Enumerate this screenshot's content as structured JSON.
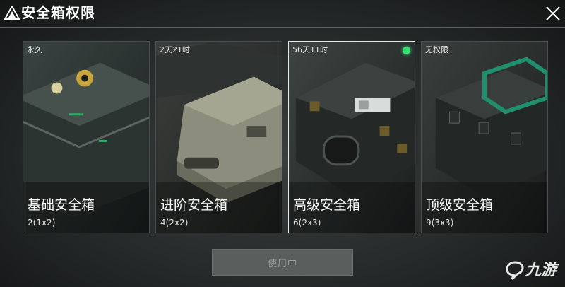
{
  "header": {
    "title": "安全箱权限",
    "logo_icon": "triangle-logo-icon",
    "close_icon": "close-icon"
  },
  "cards": [
    {
      "duration": "永久",
      "name": "基础安全箱",
      "size": "2(1x2)",
      "selected": false
    },
    {
      "duration": "2天21时",
      "name": "进阶安全箱",
      "size": "4(2x2)",
      "selected": false
    },
    {
      "duration": "56天11时",
      "name": "高级安全箱",
      "size": "6(2x3)",
      "selected": true
    },
    {
      "duration": "无权限",
      "name": "顶级安全箱",
      "size": "9(3x3)",
      "selected": false
    }
  ],
  "use_button": {
    "label": "使用中"
  },
  "watermark": {
    "text": "九游",
    "icon": "jiuyou-logo-icon"
  },
  "colors": {
    "status_active": "#3ee07a",
    "accent_teal": "#1f8f6e",
    "selected_border": "#e8ece8"
  }
}
